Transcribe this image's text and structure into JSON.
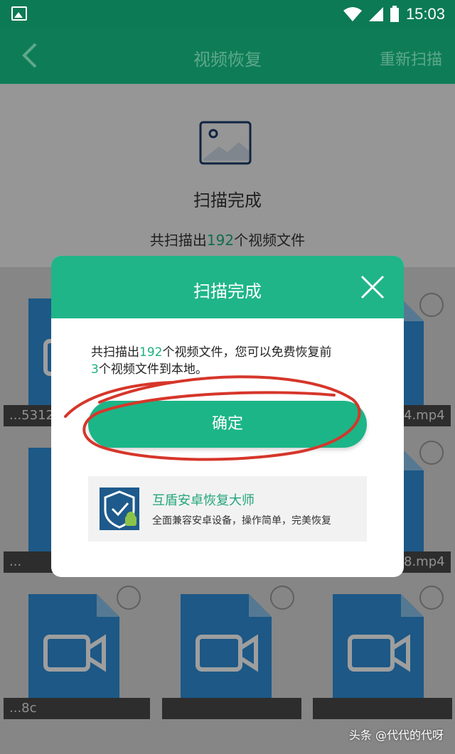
{
  "status_bar": {
    "time": "15:03",
    "icons": [
      "image-notification-icon",
      "wifi-icon",
      "signal-icon",
      "battery-icon"
    ]
  },
  "app_bar": {
    "title": "视频恢复",
    "rescan_label": "重新扫描",
    "icon": "back-arrow-icon"
  },
  "summary": {
    "heading": "扫描完成",
    "sub_prefix": "共扫描出",
    "count": "192",
    "sub_suffix": "个视频文件"
  },
  "files": [
    {
      "caption": "...5312",
      "tail": "4.mp4"
    },
    {
      "caption": "...",
      "tail": "8.mp4"
    },
    {
      "caption": "...8c"
    }
  ],
  "dialog": {
    "title": "扫描完成",
    "msg_part1": "共扫描出",
    "count": "192",
    "msg_part2": "个视频文件，您可以免费恢复前",
    "free_count": "3",
    "msg_part3": "个视频文件到本地。",
    "confirm_label": "确定",
    "promo_title": "互盾安卓恢复大师",
    "promo_desc": "全面兼容安卓设备，操作简单，完美恢复"
  },
  "watermark": "头条 @代代的代呀",
  "colors": {
    "primary": "#0e7d57",
    "accent": "#1fb589",
    "number_highlight": "#1bb07b",
    "annotation_red": "#d6362a"
  }
}
